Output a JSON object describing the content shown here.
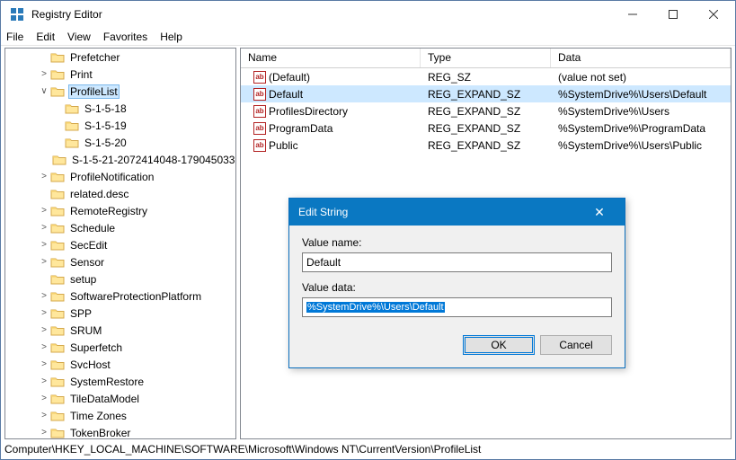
{
  "window": {
    "title": "Registry Editor"
  },
  "menu": [
    "File",
    "Edit",
    "View",
    "Favorites",
    "Help"
  ],
  "tree": {
    "items": [
      {
        "indent": 2,
        "tw": "",
        "label": "Prefetcher"
      },
      {
        "indent": 2,
        "tw": ">",
        "label": "Print"
      },
      {
        "indent": 2,
        "tw": "v",
        "label": "ProfileList",
        "sel": true
      },
      {
        "indent": 3,
        "tw": "",
        "label": "S-1-5-18"
      },
      {
        "indent": 3,
        "tw": "",
        "label": "S-1-5-19"
      },
      {
        "indent": 3,
        "tw": "",
        "label": "S-1-5-20"
      },
      {
        "indent": 3,
        "tw": "",
        "label": "S-1-5-21-2072414048-179045033"
      },
      {
        "indent": 2,
        "tw": ">",
        "label": "ProfileNotification"
      },
      {
        "indent": 2,
        "tw": "",
        "label": "related.desc"
      },
      {
        "indent": 2,
        "tw": ">",
        "label": "RemoteRegistry"
      },
      {
        "indent": 2,
        "tw": ">",
        "label": "Schedule"
      },
      {
        "indent": 2,
        "tw": ">",
        "label": "SecEdit"
      },
      {
        "indent": 2,
        "tw": ">",
        "label": "Sensor"
      },
      {
        "indent": 2,
        "tw": "",
        "label": "setup"
      },
      {
        "indent": 2,
        "tw": ">",
        "label": "SoftwareProtectionPlatform"
      },
      {
        "indent": 2,
        "tw": ">",
        "label": "SPP"
      },
      {
        "indent": 2,
        "tw": ">",
        "label": "SRUM"
      },
      {
        "indent": 2,
        "tw": ">",
        "label": "Superfetch"
      },
      {
        "indent": 2,
        "tw": ">",
        "label": "SvcHost"
      },
      {
        "indent": 2,
        "tw": ">",
        "label": "SystemRestore"
      },
      {
        "indent": 2,
        "tw": ">",
        "label": "TileDataModel"
      },
      {
        "indent": 2,
        "tw": ">",
        "label": "Time Zones"
      },
      {
        "indent": 2,
        "tw": ">",
        "label": "TokenBroker"
      }
    ]
  },
  "values": {
    "headers": {
      "name": "Name",
      "type": "Type",
      "data": "Data"
    },
    "rows": [
      {
        "name": "(Default)",
        "type": "REG_SZ",
        "data": "(value not set)"
      },
      {
        "name": "Default",
        "type": "REG_EXPAND_SZ",
        "data": "%SystemDrive%\\Users\\Default",
        "sel": true
      },
      {
        "name": "ProfilesDirectory",
        "type": "REG_EXPAND_SZ",
        "data": "%SystemDrive%\\Users"
      },
      {
        "name": "ProgramData",
        "type": "REG_EXPAND_SZ",
        "data": "%SystemDrive%\\ProgramData"
      },
      {
        "name": "Public",
        "type": "REG_EXPAND_SZ",
        "data": "%SystemDrive%\\Users\\Public"
      }
    ]
  },
  "dialog": {
    "title": "Edit String",
    "valueNameLabel": "Value name:",
    "valueName": "Default",
    "valueDataLabel": "Value data:",
    "valueData": "%SystemDrive%\\Users\\Default",
    "ok": "OK",
    "cancel": "Cancel"
  },
  "status": "Computer\\HKEY_LOCAL_MACHINE\\SOFTWARE\\Microsoft\\Windows NT\\CurrentVersion\\ProfileList"
}
